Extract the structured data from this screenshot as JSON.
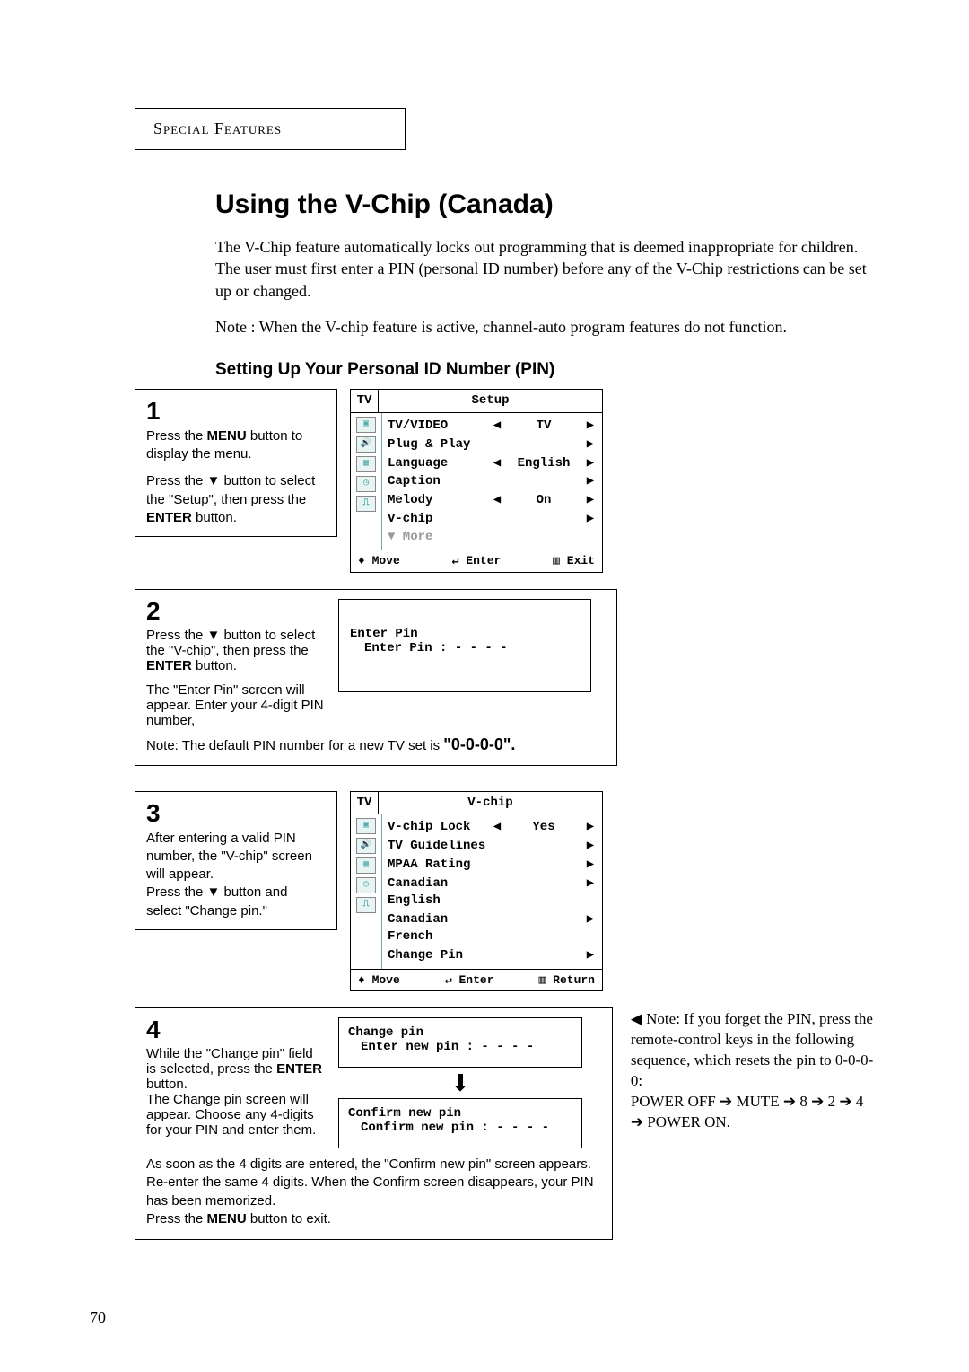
{
  "section_label": "Special Features",
  "title": "Using the V-Chip (Canada)",
  "intro": "The V-Chip feature automatically locks out programming that is deemed inappropriate for children. The user must first enter a PIN (personal ID number) before any of the V-Chip restrictions can be set up or changed.",
  "note_top": "Note : When the V-chip feature is active, channel-auto program features do not function.",
  "subhead": "Setting Up Your Personal ID Number (PIN)",
  "step1": {
    "num": "1",
    "p1a": "Press the ",
    "p1b": "MENU",
    "p1c": " button to display the menu.",
    "p2a": "Press the ▼ button to select the \"Setup\", then press the ",
    "p2b": "ENTER",
    "p2c": " button.",
    "osd": {
      "tv": "TV",
      "title": "Setup",
      "rows": [
        {
          "label": "TV/VIDEO",
          "left": "◀",
          "val": "TV",
          "right": "▶"
        },
        {
          "label": "Plug & Play",
          "left": "",
          "val": "",
          "right": "▶"
        },
        {
          "label": "Language",
          "left": "◀",
          "val": "English",
          "right": "▶"
        },
        {
          "label": "Caption",
          "left": "",
          "val": "",
          "right": "▶"
        },
        {
          "label": "Melody",
          "left": "◀",
          "val": "On",
          "right": "▶"
        },
        {
          "label": "V-chip",
          "left": "",
          "val": "",
          "right": "▶"
        }
      ],
      "more": "▼ More",
      "footL": "♦ Move",
      "footM": "↵ Enter",
      "footR": "▥ Exit"
    }
  },
  "step2": {
    "num": "2",
    "p1a": "Press the ▼ button to select  the \"V-chip\", then press the ",
    "p1b": "ENTER",
    "p1c": " button.",
    "p2": "The \"Enter Pin\" screen will appear. Enter your 4-digit PIN number,",
    "osd_title": "Enter Pin",
    "osd_line": "Enter Pin   : - - - -",
    "bottom_a": "Note: The default PIN number for a new TV set is ",
    "bottom_b": "\"0-0-0-0\"."
  },
  "step3": {
    "num": "3",
    "p": "After entering a valid PIN number, the \"V-chip\" screen will appear.\nPress the ▼ button and select \"Change pin.\"",
    "osd": {
      "tv": "TV",
      "title": "V-chip",
      "rows": [
        {
          "label": "V-chip Lock",
          "left": "◀",
          "val": "Yes",
          "right": "▶"
        },
        {
          "label": "TV Guidelines",
          "left": "",
          "val": "",
          "right": "▶"
        },
        {
          "label": "MPAA Rating",
          "left": "",
          "val": "",
          "right": "▶"
        },
        {
          "label": "Canadian English",
          "left": "",
          "val": "",
          "right": "▶"
        },
        {
          "label": "Canadian French",
          "left": "",
          "val": "",
          "right": "▶"
        },
        {
          "label": "Change Pin",
          "left": "",
          "val": "",
          "right": "▶"
        }
      ],
      "footL": "♦ Move",
      "footM": "↵ Enter",
      "footR": "▥ Return"
    }
  },
  "step4": {
    "num": "4",
    "p1a": "While the \"Change pin\" field is selected, press the ",
    "p1b": "ENTER",
    "p1c": " button.",
    "p2": "The Change pin screen will appear. Choose any 4-digits for your PIN and enter them.",
    "osd1_title": "Change pin",
    "osd1_line": "Enter new pin : - - - -",
    "osd2_title": "Confirm new pin",
    "osd2_line": "Confirm new pin : - - - -",
    "bottom_a": "As soon as the 4 digits are entered, the \"Confirm new pin\" screen appears. Re-enter the same 4 digits. When the Confirm screen disappears, your PIN has been memorized.",
    "bottom_b": "Press the ",
    "bottom_c": "MENU",
    "bottom_d": " button to exit."
  },
  "side": {
    "l1": "◀ Note: If you forget the PIN, press the remote-control keys in the following sequence, which resets the pin to 0-0-0-0:",
    "l2": "POWER OFF ➔ MUTE ➔ 8 ➔ 2 ➔ 4 ➔ POWER ON."
  },
  "page_number": "70"
}
